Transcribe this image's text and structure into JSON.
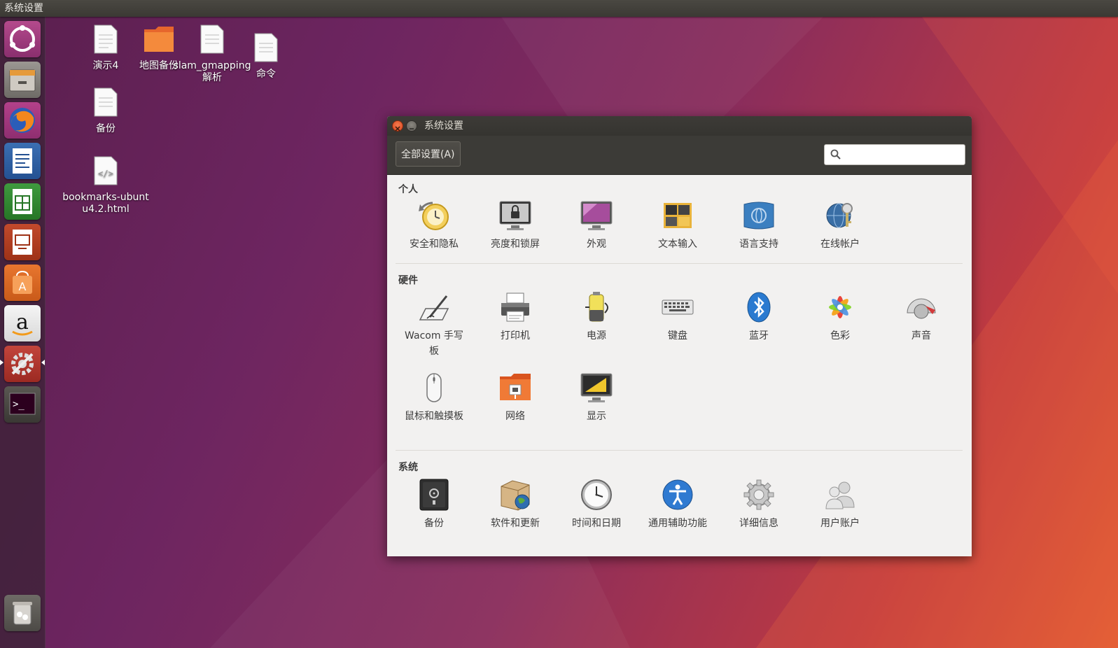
{
  "top_panel": {
    "title": "系统设置"
  },
  "launcher": {
    "items": [
      {
        "name": "ubuntu-dash-icon"
      },
      {
        "name": "files-icon"
      },
      {
        "name": "firefox-icon"
      },
      {
        "name": "libreoffice-writer-icon"
      },
      {
        "name": "libreoffice-calc-icon"
      },
      {
        "name": "libreoffice-impress-icon"
      },
      {
        "name": "software-center-icon"
      },
      {
        "name": "amazon-icon"
      },
      {
        "name": "system-settings-icon"
      },
      {
        "name": "terminal-icon"
      },
      {
        "name": "trash-icon"
      }
    ]
  },
  "desktop": {
    "icons": [
      {
        "label": "演示4",
        "type": "document"
      },
      {
        "label": "地图备份",
        "type": "folder"
      },
      {
        "label": "slam_gmapping解析",
        "type": "document"
      },
      {
        "label": "命令",
        "type": "document"
      },
      {
        "label": "备份",
        "type": "document"
      },
      {
        "label": "bookmarks-ubuntu4.2.html",
        "type": "html"
      }
    ]
  },
  "window": {
    "title": "系统设置",
    "all_settings_button": "全部设置(A)",
    "search_placeholder": "",
    "sections": [
      {
        "title": "个人",
        "items": [
          "安全和隐私",
          "亮度和锁屏",
          "外观",
          "文本输入",
          "语言支持",
          "在线帐户"
        ]
      },
      {
        "title": "硬件",
        "items": [
          "Wacom 手写板",
          "打印机",
          "电源",
          "键盘",
          "蓝牙",
          "色彩",
          "声音",
          "鼠标和触摸板",
          "网络",
          "显示"
        ]
      },
      {
        "title": "系统",
        "items": [
          "备份",
          "软件和更新",
          "时间和日期",
          "通用辅助功能",
          "详细信息",
          "用户账户"
        ]
      }
    ]
  }
}
